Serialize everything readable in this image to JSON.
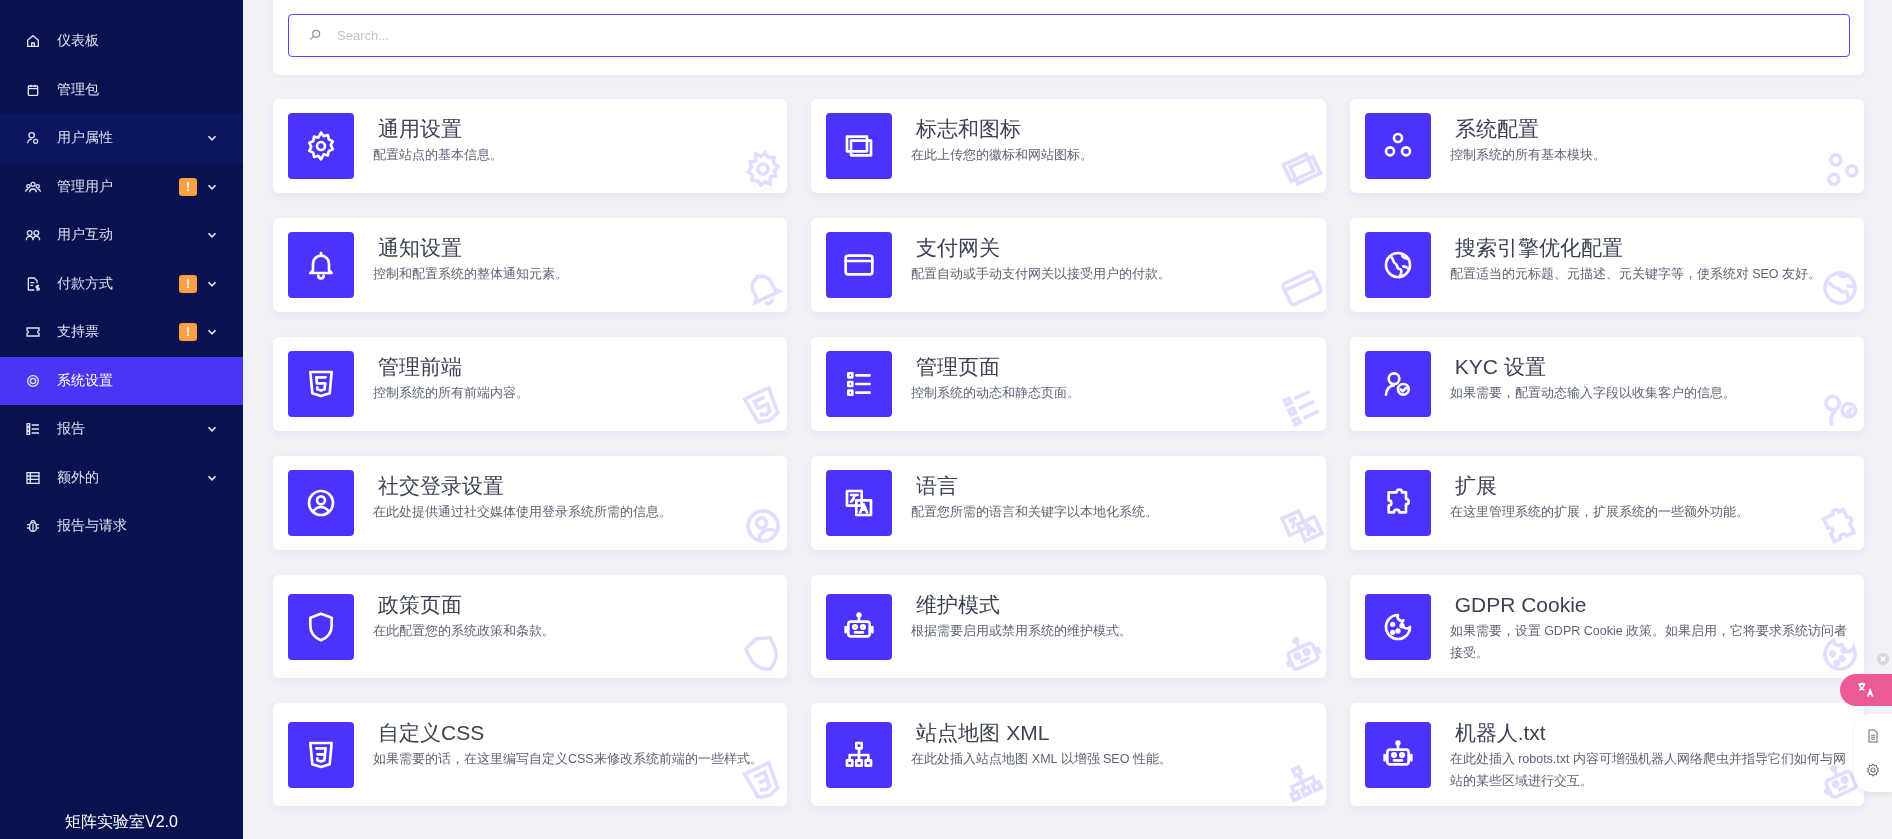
{
  "sidebar": {
    "items": [
      {
        "label": "仪表板",
        "kind": "link",
        "selected": false,
        "hovered": false
      },
      {
        "label": "管理包",
        "kind": "link",
        "selected": false,
        "hovered": false
      },
      {
        "label": "用户属性",
        "kind": "group",
        "selected": false,
        "hovered": true
      },
      {
        "label": "管理用户",
        "kind": "group",
        "selected": false,
        "hovered": false,
        "badge": "!"
      },
      {
        "label": "用户互动",
        "kind": "group",
        "selected": false,
        "hovered": false
      },
      {
        "label": "付款方式",
        "kind": "group",
        "selected": false,
        "hovered": false,
        "badge": "!"
      },
      {
        "label": "支持票",
        "kind": "group",
        "selected": false,
        "hovered": false,
        "badge": "!"
      },
      {
        "label": "系统设置",
        "kind": "link",
        "selected": true,
        "hovered": false
      },
      {
        "label": "报告",
        "kind": "group",
        "selected": false,
        "hovered": false
      },
      {
        "label": "额外的",
        "kind": "group",
        "selected": false,
        "hovered": false
      },
      {
        "label": "报告与请求",
        "kind": "link",
        "selected": false,
        "hovered": false
      }
    ],
    "footer": "矩阵实验室V2.0"
  },
  "search": {
    "placeholder": "Search..."
  },
  "cards": [
    {
      "title": "通用设置",
      "description": "配置站点的基本信息。"
    },
    {
      "title": "标志和图标",
      "description": "在此上传您的徽标和网站图标。"
    },
    {
      "title": "系统配置",
      "description": "控制系统的所有基本模块。"
    },
    {
      "title": "通知设置",
      "description": "控制和配置系统的整体通知元素。"
    },
    {
      "title": "支付网关",
      "description": "配置自动或手动支付网关以接受用户的付款。"
    },
    {
      "title": "搜索引擎优化配置",
      "description": "配置适当的元标题、元描述、元关键字等，使系统对 SEO 友好。"
    },
    {
      "title": "管理前端",
      "description": "控制系统的所有前端内容。"
    },
    {
      "title": "管理页面",
      "description": "控制系统的动态和静态页面。"
    },
    {
      "title": "KYC 设置",
      "description": "如果需要，配置动态输入字段以收集客户的信息。"
    },
    {
      "title": "社交登录设置",
      "description": "在此处提供通过社交媒体使用登录系统所需的信息。"
    },
    {
      "title": "语言",
      "description": "配置您所需的语言和关键字以本地化系统。"
    },
    {
      "title": "扩展",
      "description": "在这里管理系统的扩展，扩展系统的一些额外功能。"
    },
    {
      "title": "政策页面",
      "description": "在此配置您的系统政策和条款。"
    },
    {
      "title": "维护模式",
      "description": "根据需要启用或禁用系统的维护模式。"
    },
    {
      "title": "GDPR Cookie",
      "description": "如果需要，设置 GDPR Cookie 政策。如果启用，它将要求系统访问者接受。"
    },
    {
      "title": "自定义CSS",
      "description": "如果需要的话，在这里编写自定义CSS来修改系统前端的一些样式。"
    },
    {
      "title": "站点地图 XML",
      "description": "在此处插入站点地图 XML 以增强 SEO 性能。"
    },
    {
      "title": "机器人.txt",
      "description": "在此处插入 robots.txt 内容可增强机器人网络爬虫并指导它们如何与网站的某些区域进行交互。"
    }
  ]
}
